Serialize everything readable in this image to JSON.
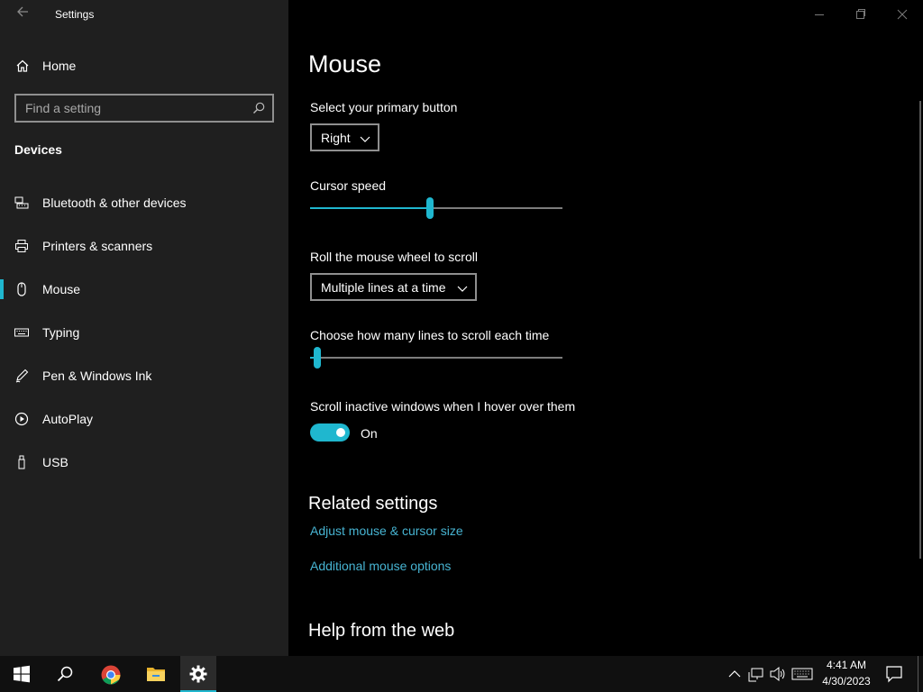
{
  "window": {
    "title": "Settings",
    "controls": {
      "minimize": "minimize",
      "restore": "restore",
      "close": "close"
    }
  },
  "sidebar": {
    "home_label": "Home",
    "search": {
      "placeholder": "Find a setting",
      "value": ""
    },
    "section_heading": "Devices",
    "items": [
      {
        "label": "Bluetooth & other devices",
        "icon": "bluetooth-devices-icon",
        "selected": false
      },
      {
        "label": "Printers & scanners",
        "icon": "printer-icon",
        "selected": false
      },
      {
        "label": "Mouse",
        "icon": "mouse-icon",
        "selected": true
      },
      {
        "label": "Typing",
        "icon": "keyboard-icon",
        "selected": false
      },
      {
        "label": "Pen & Windows Ink",
        "icon": "pen-icon",
        "selected": false
      },
      {
        "label": "AutoPlay",
        "icon": "autoplay-icon",
        "selected": false
      },
      {
        "label": "USB",
        "icon": "usb-icon",
        "selected": false
      }
    ]
  },
  "main": {
    "title": "Mouse",
    "primary_button": {
      "label": "Select your primary button",
      "value": "Right"
    },
    "cursor_speed": {
      "label": "Cursor speed",
      "level_fraction": 0.475
    },
    "wheel_scroll": {
      "label": "Roll the mouse wheel to scroll",
      "value": "Multiple lines at a time"
    },
    "scroll_lines": {
      "label": "Choose how many lines to scroll each time",
      "level_fraction": 0.03
    },
    "inactive_scroll": {
      "label": "Scroll inactive windows when I hover over them",
      "state": "On"
    },
    "related": {
      "title": "Related settings",
      "links": [
        "Adjust mouse & cursor size",
        "Additional mouse options"
      ]
    },
    "help_title": "Help from the web"
  },
  "taskbar": {
    "apps": [
      "start-icon",
      "search-icon",
      "chrome-icon",
      "file-explorer-icon",
      "settings-icon"
    ],
    "active_app": "settings-icon",
    "clock": {
      "time": "4:41 AM",
      "date": "4/30/2023"
    }
  },
  "colors": {
    "accent": "#1fb7cf",
    "link": "#47b4d2",
    "sidebar_bg": "#1f1f1f",
    "content_bg": "#000000",
    "taskbar_bg": "#101010"
  }
}
